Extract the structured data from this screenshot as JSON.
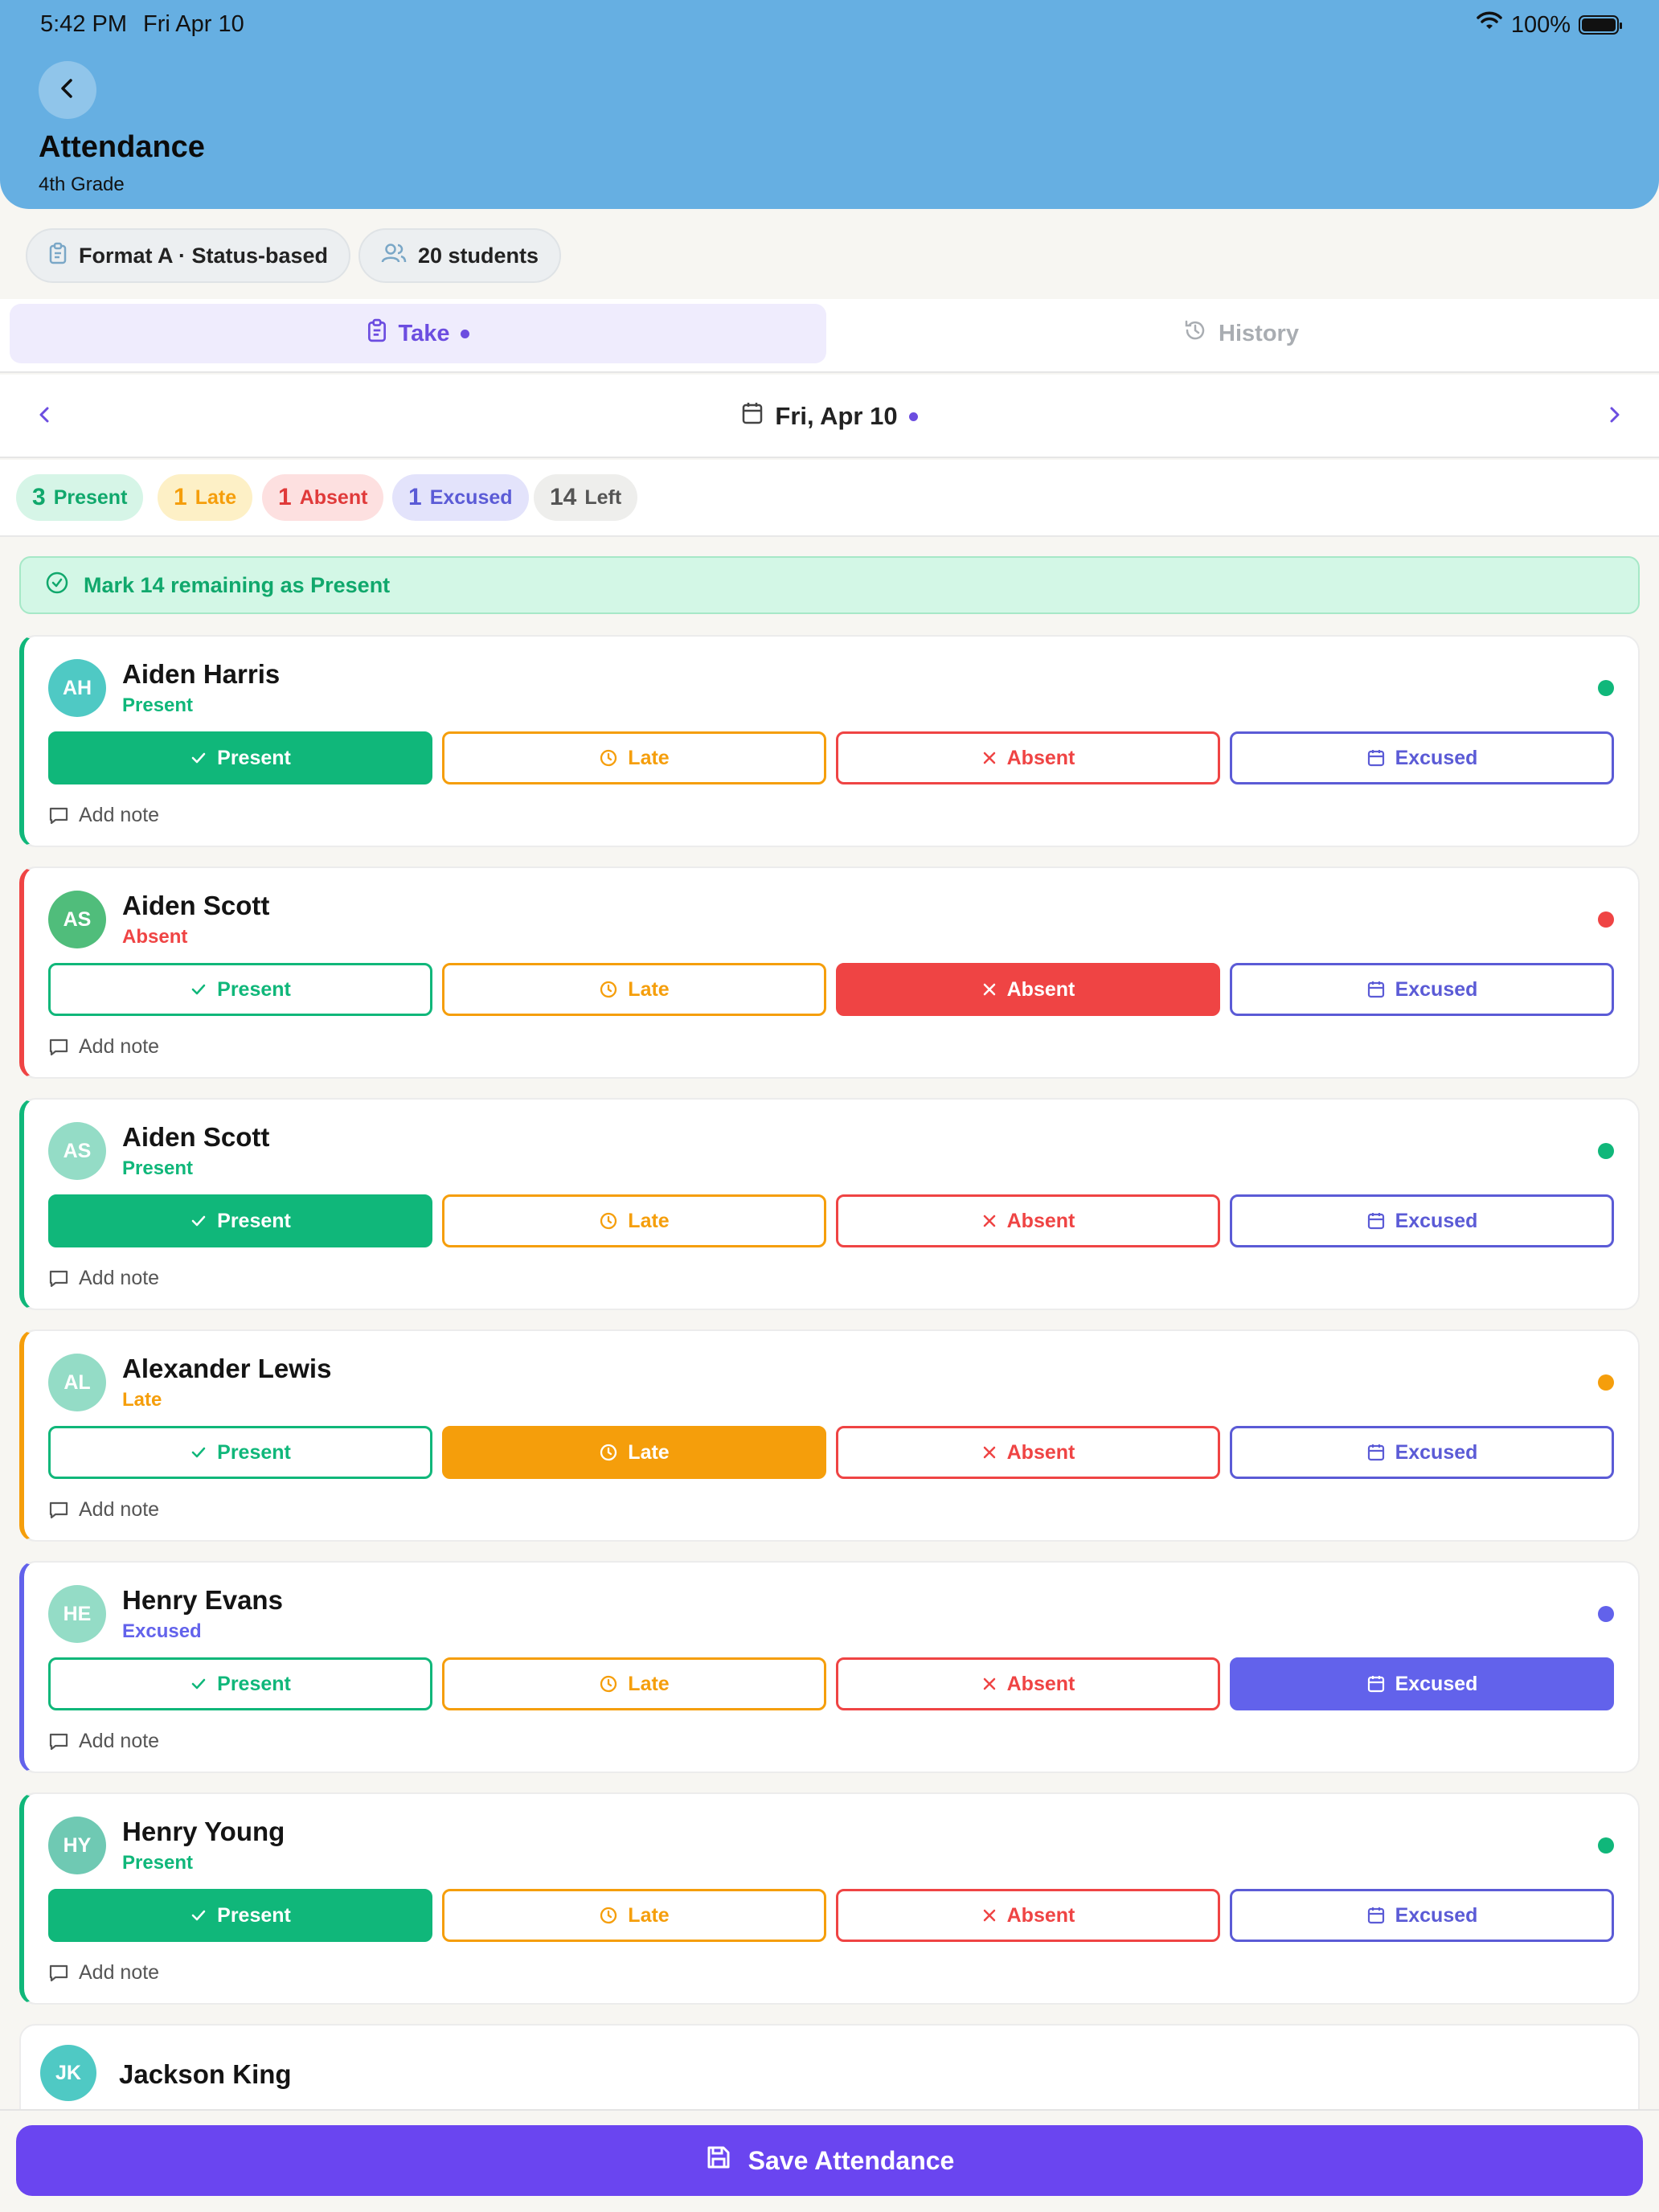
{
  "status_bar": {
    "time": "5:42 PM",
    "date": "Fri Apr 10",
    "battery": "100%",
    "battery_level": 1.0
  },
  "header": {
    "title": "Attendance",
    "subtitle": "4th Grade"
  },
  "info_chips": {
    "format": "Format A · Status-based",
    "students": "20 students"
  },
  "tabs": {
    "take": "Take",
    "history": "History",
    "active": "take"
  },
  "date_nav": {
    "date": "Fri, Apr 10"
  },
  "summary": [
    {
      "count": "3",
      "label": "Present",
      "bg": "#d6f5e7",
      "color": "#10a86c"
    },
    {
      "count": "1",
      "label": "Late",
      "bg": "#fdf0c6",
      "color": "#f59e0b"
    },
    {
      "count": "1",
      "label": "Absent",
      "bg": "#fde0e0",
      "color": "#e03a3a"
    },
    {
      "count": "1",
      "label": "Excused",
      "bg": "#e3e3fb",
      "color": "#5b5bd6"
    },
    {
      "count": "14",
      "label": "Left",
      "bg": "#eeeeec",
      "color": "#555555"
    }
  ],
  "mark_remaining": "Mark 14 remaining as Present",
  "buttons": {
    "present": "Present",
    "late": "Late",
    "absent": "Absent",
    "excused": "Excused"
  },
  "add_note": "Add note",
  "students": [
    {
      "initials": "AH",
      "name": "Aiden Harris",
      "status": "Present",
      "status_key": "present",
      "avatar_color": "#4fc9c4"
    },
    {
      "initials": "AS",
      "name": "Aiden Scott",
      "status": "Absent",
      "status_key": "absent",
      "avatar_color": "#50bd7b"
    },
    {
      "initials": "AS",
      "name": "Aiden Scott",
      "status": "Present",
      "status_key": "present",
      "avatar_color": "#94dcc6"
    },
    {
      "initials": "AL",
      "name": "Alexander Lewis",
      "status": "Late",
      "status_key": "late",
      "avatar_color": "#94dcc6"
    },
    {
      "initials": "HE",
      "name": "Henry Evans",
      "status": "Excused",
      "status_key": "excused",
      "avatar_color": "#94dcc6"
    },
    {
      "initials": "HY",
      "name": "Henry Young",
      "status": "Present",
      "status_key": "present",
      "avatar_color": "#6fc9b3"
    }
  ],
  "partial_student": {
    "initials": "JK",
    "name": "Jackson King",
    "avatar_color": "#4fc9c4"
  },
  "save_button": "Save Attendance",
  "colors": {
    "present": "#10b77a",
    "late": "#f59e0b",
    "absent": "#ef4444",
    "excused": "#6262eb",
    "accent": "#6a45f0",
    "header": "#66afe2"
  }
}
